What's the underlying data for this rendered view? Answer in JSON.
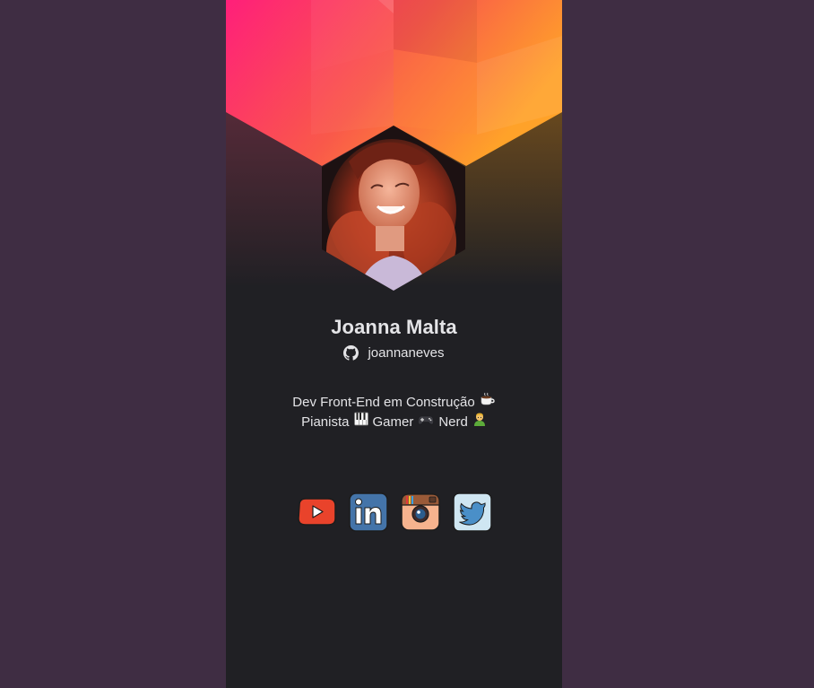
{
  "profile": {
    "name": "Joanna Malta",
    "github_user": "joannaneves",
    "bio_line1": "Dev Front-End em Construção",
    "bio_line2_a": "Pianista",
    "bio_line2_b": "Gamer",
    "bio_line2_c": "Nerd"
  },
  "icons": {
    "github": "github-icon",
    "coffee": "coffee-emoji",
    "piano": "piano-emoji",
    "gamepad": "gamepad-emoji",
    "nerd": "nerd-emoji"
  },
  "socials": [
    {
      "name": "youtube-icon",
      "label": "YouTube"
    },
    {
      "name": "linkedin-icon",
      "label": "LinkedIn"
    },
    {
      "name": "instagram-icon",
      "label": "Instagram"
    },
    {
      "name": "twitter-icon",
      "label": "Twitter"
    }
  ],
  "colors": {
    "page_bg": "#3f2d43",
    "card_bg": "#202024",
    "gradient_start": "#ff1f7a",
    "gradient_end": "#ffa229",
    "text": "#e4e4e7"
  }
}
